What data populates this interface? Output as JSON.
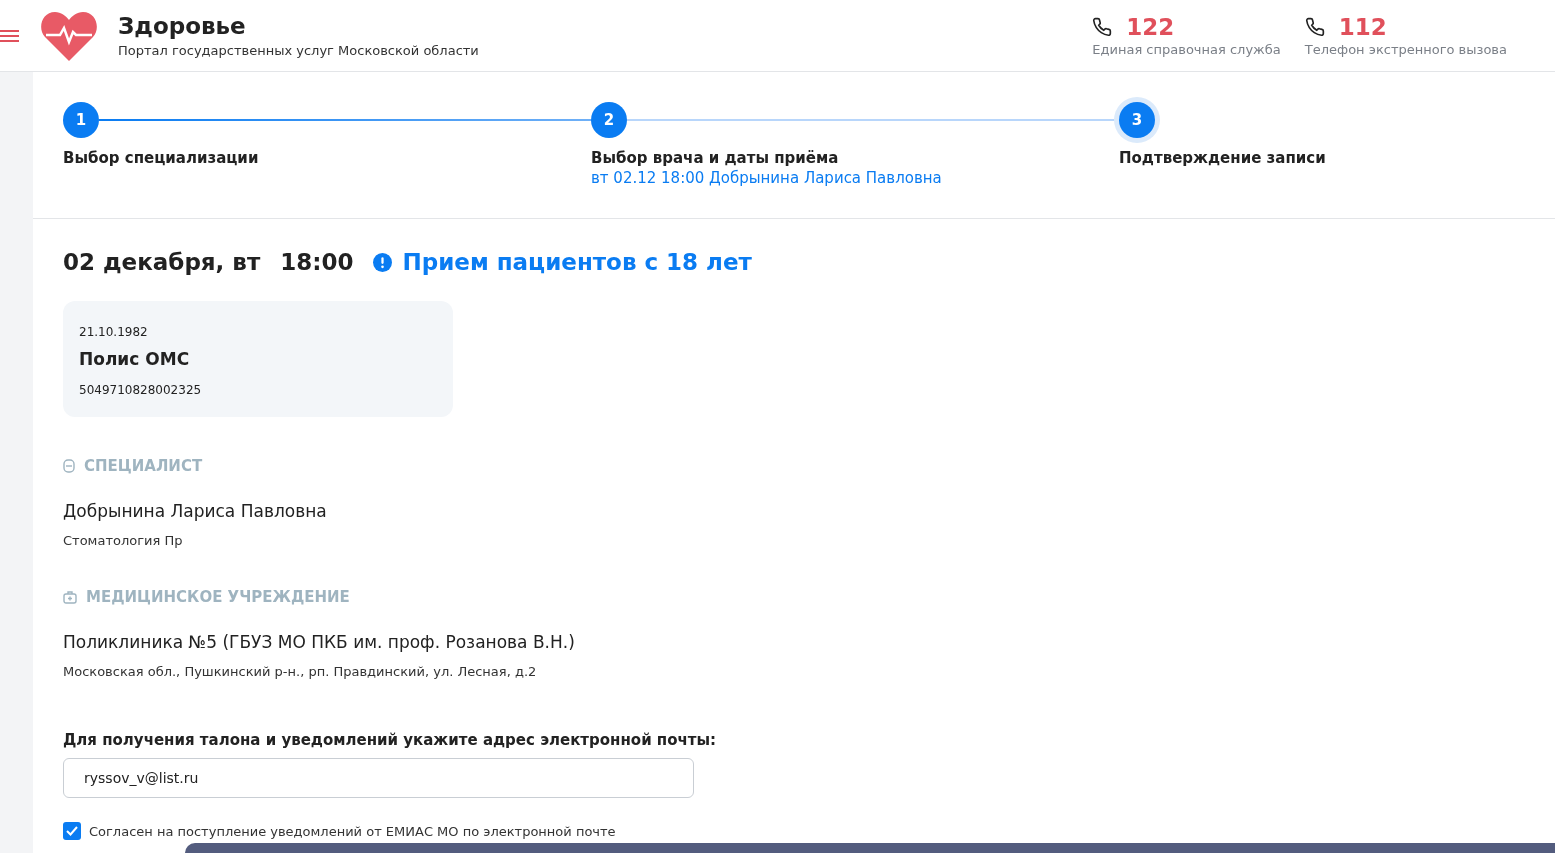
{
  "header": {
    "title": "Здоровье",
    "subtitle": "Портал государственных услуг Московской области",
    "phones": [
      {
        "number": "122",
        "label": "Единая справочная служба"
      },
      {
        "number": "112",
        "label": "Телефон экстренного вызова"
      }
    ]
  },
  "steps": [
    {
      "number": "1",
      "title": "Выбор специализации",
      "selected": false
    },
    {
      "number": "2",
      "title": "Выбор врача и даты приёма",
      "subtitle": "вт 02.12 18:00 Добрынина Лариса Павловна",
      "selected": false
    },
    {
      "number": "3",
      "title": "Подтверждение записи",
      "selected": true
    }
  ],
  "appointment": {
    "date": "02 декабря, вт",
    "time": "18:00",
    "notice": "Прием пациентов с 18 лет"
  },
  "policy_card": {
    "birth_date": "21.10.1982",
    "title": "Полис ОМС",
    "number": "5049710828002325"
  },
  "sections": [
    {
      "kind": "specialist",
      "label": "СПЕЦИАЛИСТ",
      "name": "Добрынина Лариса Павловна",
      "detail": "Стоматология Пр"
    },
    {
      "kind": "clinic",
      "label": "МЕДИЦИНСКОЕ УЧРЕЖДЕНИЕ",
      "name": "Поликлиника №5 (ГБУЗ МО ПКБ им. проф. Розанова В.Н.)",
      "detail": "Московская обл., Пушкинский р-н., рп. Правдинский, ул. Лесная, д.2"
    }
  ],
  "email": {
    "label": "Для получения талона и уведомлений укажите адрес электронной почты:",
    "value": "ryssov_v@list.ru"
  },
  "consent": {
    "label": "Согласен на поступление уведомлений от ЕМИАС МО по электронной почте",
    "checked": true
  }
}
